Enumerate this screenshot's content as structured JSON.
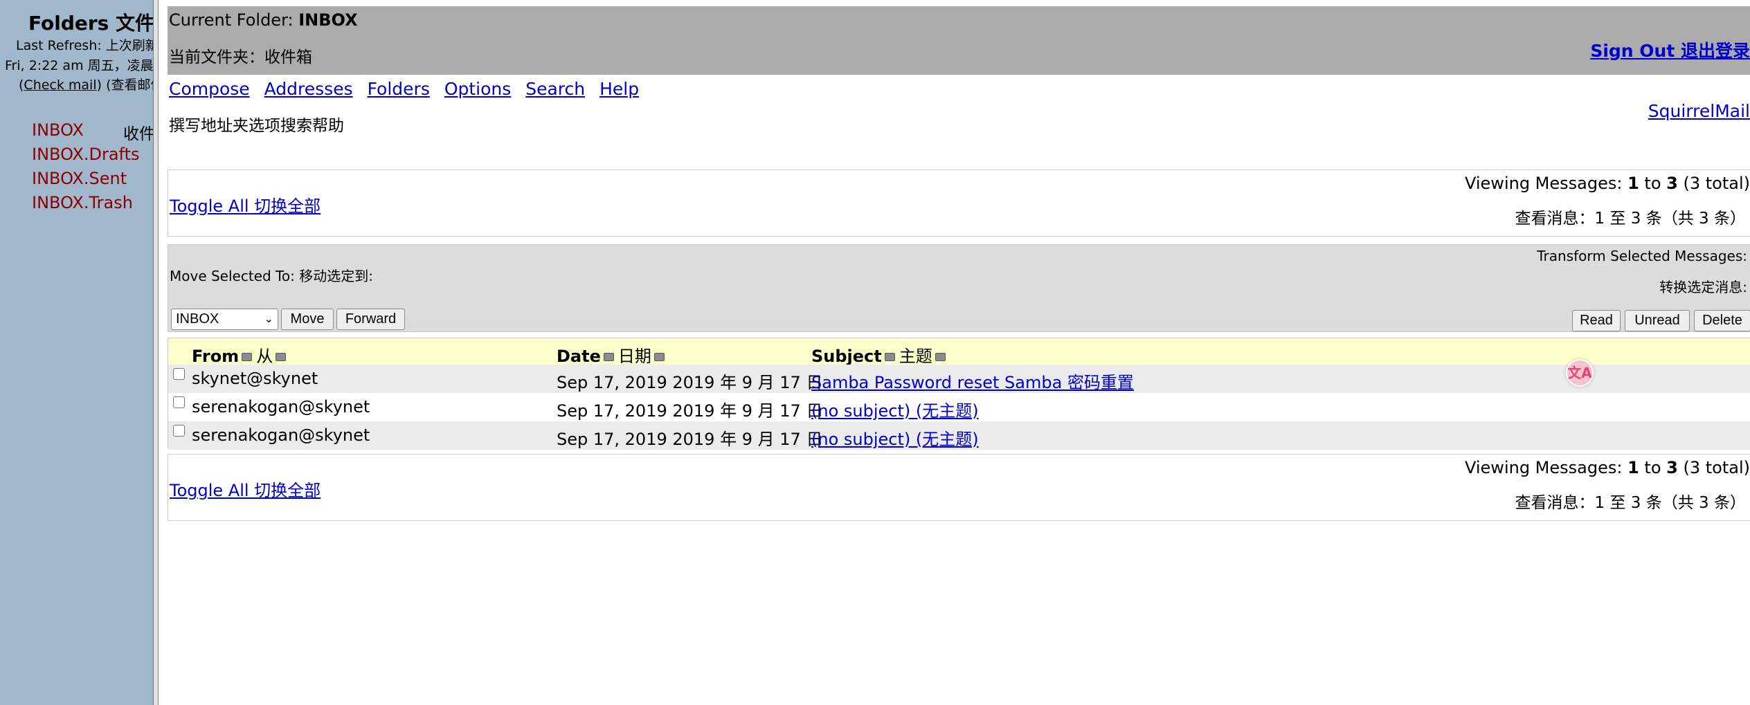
{
  "sidebar": {
    "title": "Folders  文件夹",
    "last_refresh_label": "Last Refresh:  上次刷新",
    "last_refresh_time": "Fri, 2:22 am  周五，凌晨",
    "check_mail_prefix": "(",
    "check_mail_link": "Check mail",
    "check_mail_suffix": ") (查看邮件)",
    "folders": [
      {
        "name": "INBOX",
        "cn": "收件箱"
      },
      {
        "name": "INBOX.Drafts"
      },
      {
        "name": "INBOX.Sent"
      },
      {
        "name": "INBOX.Trash"
      }
    ]
  },
  "topbar": {
    "current_folder_label": "Current Folder: ",
    "current_folder_name": "INBOX",
    "current_folder_cn": "当前文件夹：收件箱",
    "sign_out": "Sign Out  退出登录"
  },
  "nav": {
    "links": [
      "Compose",
      "Addresses",
      "Folders",
      "Options",
      "Search",
      "Help"
    ],
    "cn": "撰写地址夹选项搜索帮助",
    "squirrelmail": "SquirrelMail"
  },
  "viewing": {
    "toggle_all": "Toggle All  切换全部",
    "prefix": "Viewing Messages: ",
    "from": "1",
    "to_word": " to ",
    "to": "3",
    "total": " (3 total)",
    "cn": "查看消息：1 至 3 条（共 3 条）"
  },
  "actions": {
    "move_label": "Move Selected To:   移动选定到:",
    "transform_label": "Transform Selected Messages:",
    "transform_cn": "转换选定消息:",
    "selected_folder": "INBOX",
    "move_button": "Move",
    "forward_button": "Forward",
    "read_button": "Read",
    "unread_button": "Unread",
    "delete_button": "Delete"
  },
  "table": {
    "headers": {
      "from": "From",
      "from_cn": "从",
      "date": "Date",
      "date_cn": "日期",
      "subject": "Subject",
      "subject_cn": "主题"
    },
    "rows": [
      {
        "from": "skynet@skynet",
        "date": "Sep 17, 2019  2019 年 9 月 17 日",
        "subject": "Samba Password reset  Samba 密码重置"
      },
      {
        "from": "serenakogan@skynet",
        "date": "Sep 17, 2019  2019 年 9 月 17 日",
        "subject": "(no subject)  (无主题)"
      },
      {
        "from": "serenakogan@skynet",
        "date": "Sep 17, 2019  2019 年 9 月 17 日",
        "subject": "(no subject)  (无主题)"
      }
    ]
  },
  "translate_badge": "文A",
  "colors": {
    "sidebar_bg": "#a1b7cb",
    "folder_link": "#8b0000",
    "topbar_bg": "#ababab",
    "header_row_bg": "#ffffcc",
    "link": "#0000cc"
  }
}
